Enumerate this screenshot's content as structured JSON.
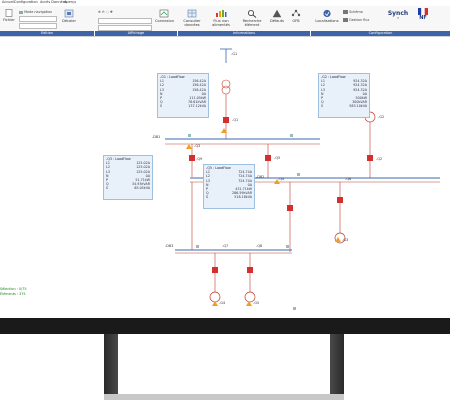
{
  "menubar": {
    "items": [
      "Accueil",
      "Configuration",
      "Accès Données",
      "Aperçu"
    ]
  },
  "ribbon": {
    "buttons": {
      "fichier": "Fichier",
      "mode_navigation": "Mode navigation",
      "decaler": "Décaler",
      "connexion": "Connexion",
      "consulter_donnees": "Consulter données",
      "flux_non_alimentes": "Flux non alimentés",
      "recherche_element": "Recherche élément",
      "defauts": "Défauts",
      "gfb": "GFB",
      "localisations": "Localisations",
      "schema": "Schéma",
      "gestion_flux": "Gestion flux",
      "synch": "Synch",
      "nf": "NF"
    },
    "groups": [
      "Edition",
      "Affichage",
      "Informations",
      "Configuration"
    ]
  },
  "diagram": {
    "bus_left": "-DB1",
    "bus_mid": "-DB2",
    "bus_bottom": "-DB3",
    "labels": {
      "g1": "-G1",
      "q1": "-Q1",
      "q3": "-Q3",
      "q4": "-Q4",
      "q5": "-Q5",
      "q6": "-Q6",
      "q7": "-Q7",
      "q8": "-Q8",
      "q9": "-Q9",
      "g2": "-G2",
      "g3": "-G3",
      "g4": "-G4",
      "g5": "-G5",
      "q2": "-Q2"
    },
    "loadflow_boxes": [
      {
        "title": "-G1 : LoadFlow",
        "rows": [
          [
            "L1",
            "156.42A"
          ],
          [
            "L2",
            "156.42A"
          ],
          [
            "L3",
            "156.42A"
          ],
          [
            "N",
            "0A"
          ],
          [
            "P",
            "111.05kW"
          ],
          [
            "Q",
            "78.61kVAR"
          ],
          [
            "S",
            "137.12kVA"
          ]
        ]
      },
      {
        "title": "-G2 : LoadFlow",
        "rows": [
          [
            "L1",
            "924.32A"
          ],
          [
            "L2",
            "924.32A"
          ],
          [
            "L3",
            "924.32A"
          ],
          [
            "N",
            "0A"
          ],
          [
            "P",
            "500kW"
          ],
          [
            "Q",
            "300kVAR"
          ],
          [
            "S",
            "583.10kVA"
          ]
        ]
      },
      {
        "title": "-Q3 : LoadFlow",
        "rows": [
          [
            "L1",
            "125.02A"
          ],
          [
            "L2",
            "125.02A"
          ],
          [
            "L3",
            "125.02A"
          ],
          [
            "N",
            "0A"
          ],
          [
            "P",
            "51.71kW"
          ],
          [
            "Q",
            "34.93kVAR"
          ],
          [
            "S",
            "65.05kVA"
          ]
        ]
      },
      {
        "title": "-Q5 : LoadFlow",
        "rows": [
          [
            "L1",
            "724.74A"
          ],
          [
            "L2",
            "724.74A"
          ],
          [
            "L3",
            "724.74A"
          ],
          [
            "N",
            "0A"
          ],
          [
            "P",
            "431.71kW"
          ],
          [
            "Q",
            "286.59kVAR"
          ],
          [
            "S",
            "518.18kVA"
          ]
        ]
      }
    ]
  },
  "statusbar": {
    "line1": "Sélection : 0/75",
    "line2": "Éléments : 375"
  },
  "colors": {
    "ribbon_group": "#3d64a8",
    "lf_box_bg": "#e8f1fa",
    "bus_line": "#c0392b",
    "breaker_red": "#d32f2f",
    "status_green": "#1a7f1a"
  }
}
